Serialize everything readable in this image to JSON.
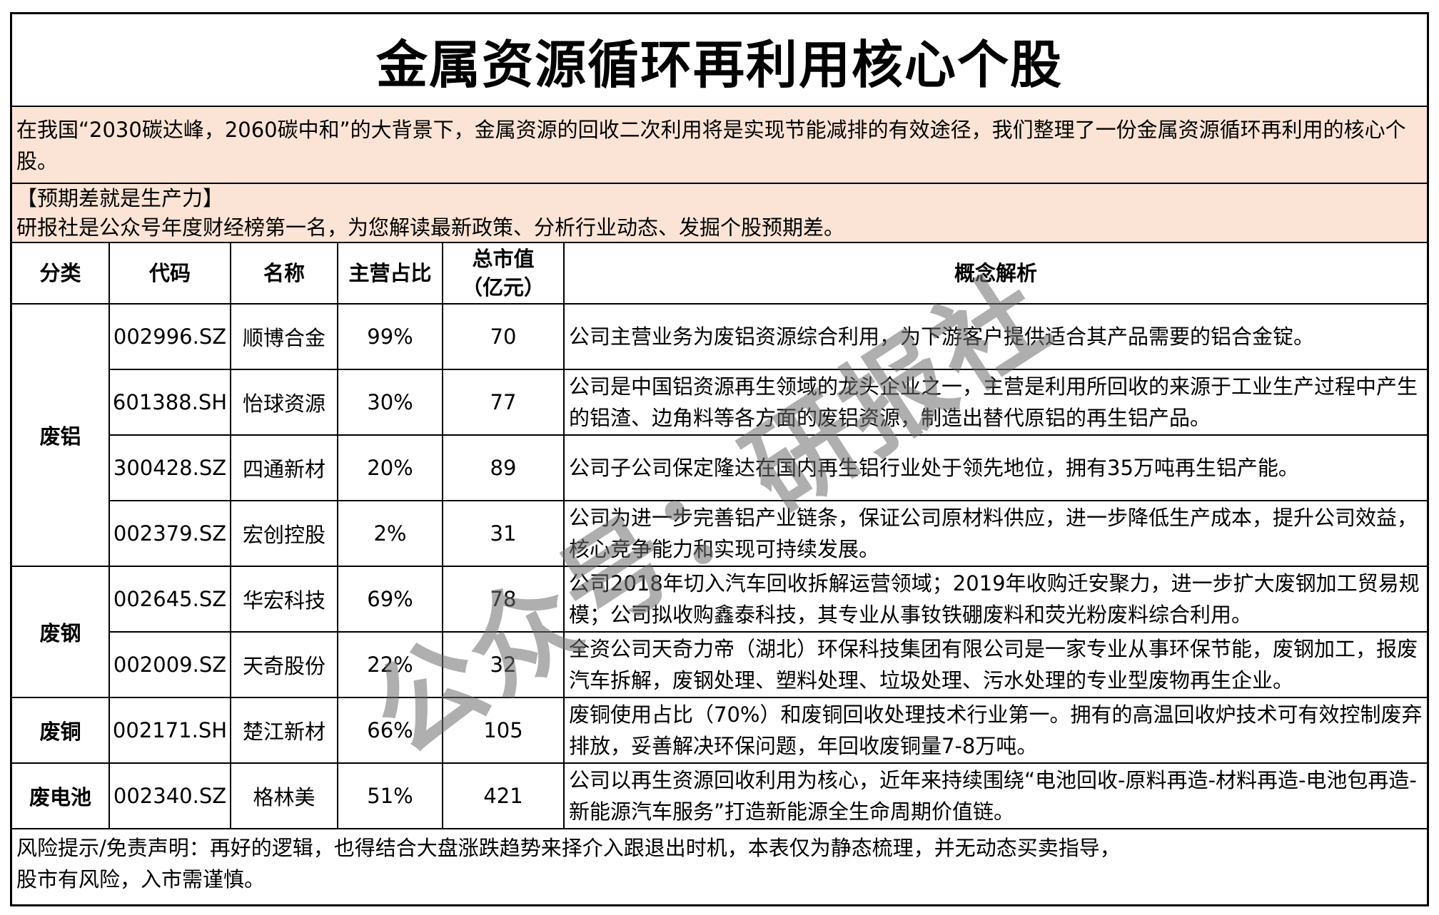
{
  "title": "金属资源循环再利用核心个股",
  "intro": "在我国“2030碳达峰，2060碳中和”的大背景下，金属资源的回收二次利用将是实现节能减排的有效途径，我们整理了一份金属资源循环再利用的核心个股。",
  "promo": {
    "heading": "【预期差就是生产力】",
    "text": "研报社是公众号年度财经榜第一名，为您解读最新政策、分析行业动态、发掘个股预期差。"
  },
  "headers": {
    "category": "分类",
    "code": "代码",
    "name": "名称",
    "share": "主营占比",
    "cap_line1": "总市值",
    "cap_line2": "（亿元）",
    "concept": "概念解析"
  },
  "categories": [
    "废铝",
    "废钢",
    "废铜",
    "废电池"
  ],
  "rows": [
    {
      "code": "002996.SZ",
      "name": "顺博合金",
      "share": "99%",
      "cap": "70",
      "desc": "公司主营业务为废铝资源综合利用，为下游客户提供适合其产品需要的铝合金锭。"
    },
    {
      "code": "601388.SH",
      "name": "怡球资源",
      "share": "30%",
      "cap": "77",
      "desc": "公司是中国铝资源再生领域的龙头企业之一，主营是利用所回收的来源于工业生产过程中产生的铝渣、边角料等各方面的废铝资源，制造出替代原铝的再生铝产品。"
    },
    {
      "code": "300428.SZ",
      "name": "四通新材",
      "share": "20%",
      "cap": "89",
      "desc": "公司子公司保定隆达在国内再生铝行业处于领先地位，拥有35万吨再生铝产能。"
    },
    {
      "code": "002379.SZ",
      "name": "宏创控股",
      "share": "2%",
      "cap": "31",
      "desc": "公司为进一步完善铝产业链条，保证公司原材料供应，进一步降低生产成本，提升公司效益，核心竞争能力和实现可持续发展。"
    },
    {
      "code": "002645.SZ",
      "name": "华宏科技",
      "share": "69%",
      "cap": "78",
      "desc": " 公司2018年切入汽车回收拆解运营领域；2019年收购迁安聚力，进一步扩大废钢加工贸易规模；公司拟收购鑫泰科技，其专业从事钕铁硼废料和荧光粉废料综合利用。"
    },
    {
      "code": "002009.SZ",
      "name": "天奇股份",
      "share": "22%",
      "cap": "32",
      "desc": "全资公司天奇力帝（湖北）环保科技集团有限公司是一家专业从事环保节能，废钢加工，报废汽车拆解，废钢处理、塑料处理、垃圾处理、污水处理的专业型废物再生企业。"
    },
    {
      "code": "002171.SH",
      "name": "楚江新材",
      "share": "66%",
      "cap": "105",
      "desc": "废铜使用占比（70%）和废铜回收处理技术行业第一。拥有的高温回收炉技术可有效控制废弃排放，妥善解决环保问题，年回收废铜量7-8万吨。"
    },
    {
      "code": "002340.SZ",
      "name": "格林美",
      "share": "51%",
      "cap": "421",
      "desc": "公司以再生资源回收利用为核心，近年来持续围绕“电池回收-原料再造-材料再造-电池包再造-新能源汽车服务”打造新能源全生命周期价值链。"
    }
  ],
  "footer": {
    "line1": "风险提示/免责声明：再好的逻辑，也得结合大盘涨跌趋势来择介入跟退出时机，本表仅为静态梳理，并无动态买卖指导，",
    "line2": "股市有风险，入市需谨慎。"
  },
  "watermark": "公众号：研报社"
}
